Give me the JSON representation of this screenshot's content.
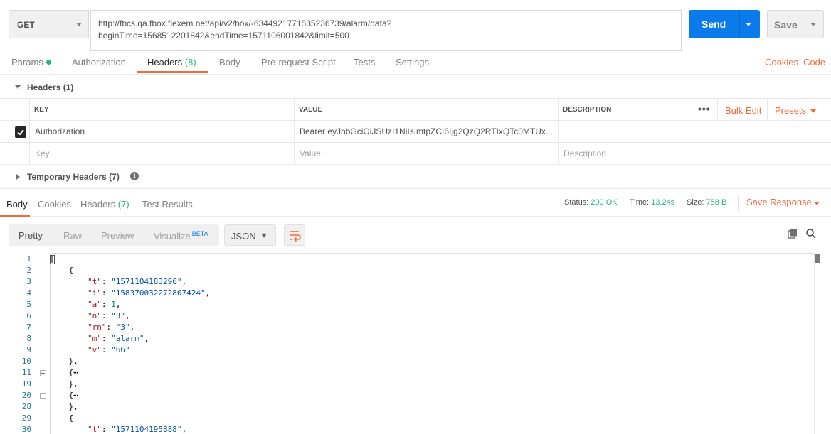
{
  "request": {
    "method": "GET",
    "url_line1": "http://fbcs.qa.fbox.flexem.net/api/v2/box/-6344921771535236739/alarm/data?",
    "url_line2": "beginTime=1568512201842&endTime=1571106001842&limit=500",
    "send_label": "Send",
    "save_label": "Save"
  },
  "request_tabs": {
    "params": "Params",
    "authorization": "Authorization",
    "headers": "Headers",
    "headers_count": "(8)",
    "body": "Body",
    "pre_request": "Pre-request Script",
    "tests": "Tests",
    "settings": "Settings",
    "cookies": "Cookies",
    "code": "Code"
  },
  "headers_section": {
    "title": "Headers (1)",
    "col_key": "KEY",
    "col_value": "VALUE",
    "col_description": "DESCRIPTION",
    "bulk_edit": "Bulk Edit",
    "presets": "Presets",
    "rows": [
      {
        "key": "Authorization",
        "value": "Bearer eyJhbGciOiJSUzI1NiIsImtpZCI6Ijg2QzQ2RTIxQTc0MTUx...",
        "checked": true
      }
    ],
    "placeholder_key": "Key",
    "placeholder_value": "Value",
    "placeholder_description": "Description",
    "temporary_title": "Temporary Headers",
    "temporary_count": "(7)"
  },
  "response_tabs": {
    "body": "Body",
    "cookies": "Cookies",
    "headers": "Headers",
    "headers_count": "(7)",
    "test_results": "Test Results"
  },
  "response_meta": {
    "status_label": "Status:",
    "status_value": "200 OK",
    "time_label": "Time:",
    "time_value": "13.24s",
    "size_label": "Size:",
    "size_value": "758 B",
    "save_response": "Save Response"
  },
  "view": {
    "pretty": "Pretty",
    "raw": "Raw",
    "preview": "Preview",
    "visualize": "Visualize",
    "beta": "BETA",
    "format": "JSON"
  },
  "code_lines": [
    {
      "n": "1",
      "text": "["
    },
    {
      "n": "2",
      "text": "    {"
    },
    {
      "n": "3",
      "key": "\"t\"",
      "val": "\"1571104183296\"",
      "type": "s"
    },
    {
      "n": "4",
      "key": "\"i\"",
      "val": "\"158370032272807424\"",
      "type": "s"
    },
    {
      "n": "5",
      "key": "\"a\"",
      "val": "1",
      "type": "n"
    },
    {
      "n": "6",
      "key": "\"n\"",
      "val": "\"3\"",
      "type": "s"
    },
    {
      "n": "7",
      "key": "\"rn\"",
      "val": "\"3\"",
      "type": "s"
    },
    {
      "n": "8",
      "key": "\"m\"",
      "val": "\"alarm\"",
      "type": "s"
    },
    {
      "n": "9",
      "key": "\"v\"",
      "val": "\"66\"",
      "type": "s",
      "last": true
    },
    {
      "n": "10",
      "text": "    },"
    },
    {
      "n": "11",
      "text": "    {⋯",
      "fold": true
    },
    {
      "n": "19",
      "text": "    },"
    },
    {
      "n": "20",
      "text": "    {⋯",
      "fold": true
    },
    {
      "n": "28",
      "text": "    },"
    },
    {
      "n": "29",
      "text": "    {"
    },
    {
      "n": "30",
      "key": "\"t\"",
      "val": "\"1571104195888\"",
      "type": "s"
    }
  ]
}
